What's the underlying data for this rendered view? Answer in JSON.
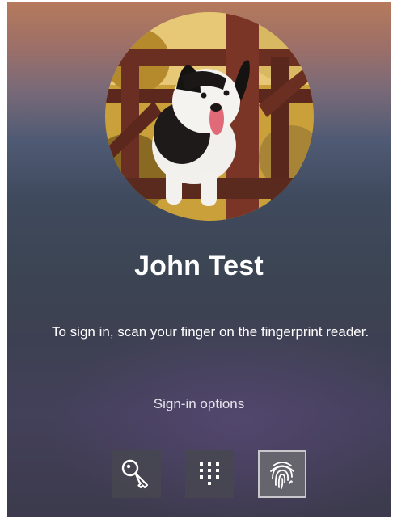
{
  "user": {
    "name": "John Test",
    "avatar_description": "dog-on-wooden-railing-photo"
  },
  "prompt": {
    "instruction": "To sign in, scan your finger on the fingerprint reader."
  },
  "signin": {
    "options_label": "Sign-in options",
    "buttons": [
      {
        "id": "password",
        "icon": "key-icon",
        "selected": false
      },
      {
        "id": "pin",
        "icon": "pin-keypad-icon",
        "selected": false
      },
      {
        "id": "fingerprint",
        "icon": "fingerprint-icon",
        "selected": true
      }
    ]
  },
  "colors": {
    "text": "#ffffff",
    "button_bg": "#46464f",
    "button_selected_border": "#c8c8cc"
  }
}
